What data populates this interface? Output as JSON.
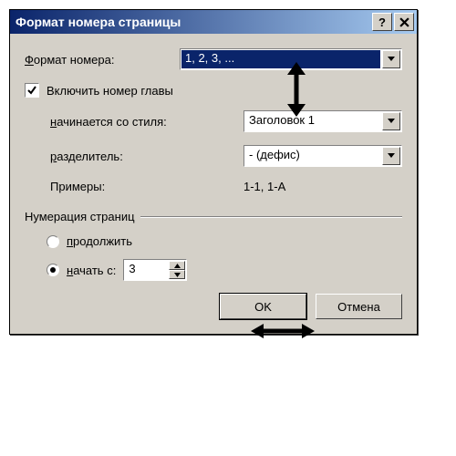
{
  "titlebar": {
    "title": "Формат номера страницы",
    "help": "?",
    "close": "×"
  },
  "format": {
    "label_pre": "",
    "label_u": "Ф",
    "label_post": "ормат номера:",
    "value": "1, 2, 3, ..."
  },
  "include_chapter": {
    "label": "Включить номер главы"
  },
  "starts_style": {
    "label_u": "н",
    "label_post": "ачинается со стиля:",
    "value": "Заголовок 1"
  },
  "separator": {
    "label_u": "р",
    "label_post": "азделитель:",
    "value": "-   (дефис)"
  },
  "examples": {
    "label": "Примеры:",
    "value": "1-1, 1-A"
  },
  "numbering": {
    "group": "Нумерация страниц",
    "continue_u": "п",
    "continue_post": "родолжить",
    "start_u": "н",
    "start_post": "ачать с:",
    "start_value": "3"
  },
  "buttons": {
    "ok": "OK",
    "cancel": "Отмена"
  }
}
